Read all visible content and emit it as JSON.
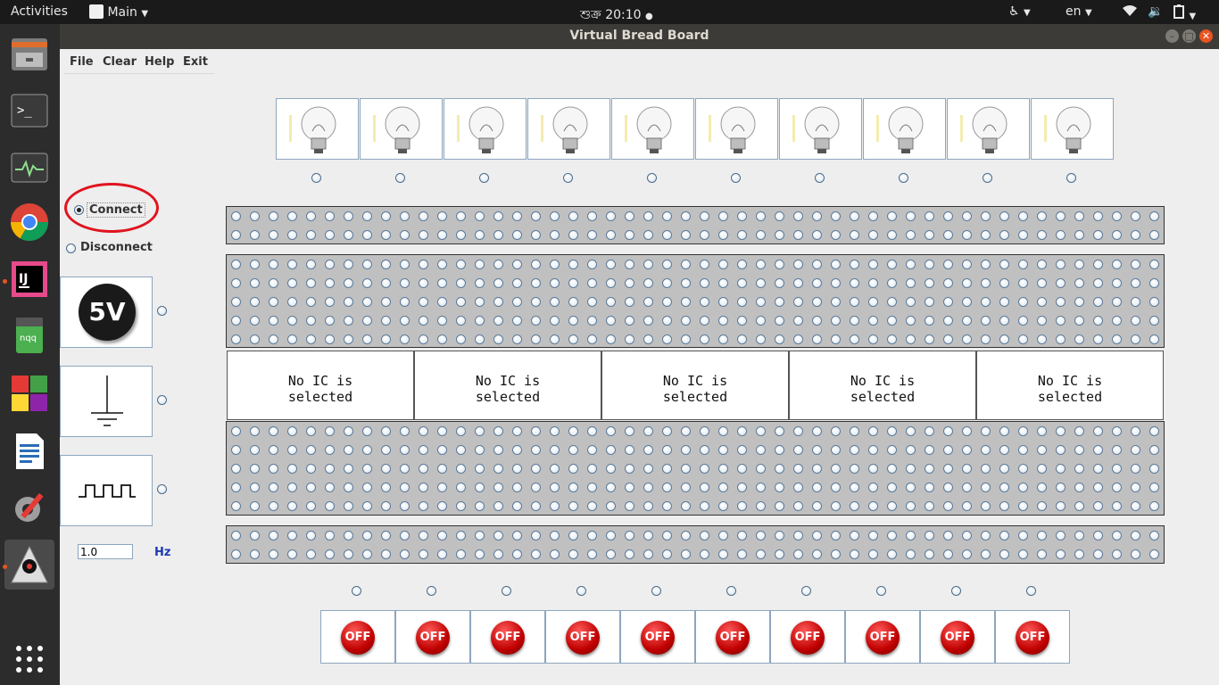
{
  "topbar": {
    "activities": "Activities",
    "app_menu": "Main",
    "clock": "শুক্র 20:10",
    "lang": "en"
  },
  "window": {
    "title": "Virtual Bread Board"
  },
  "menubar": {
    "items": [
      "File",
      "Clear",
      "Help",
      "Exit"
    ]
  },
  "connection": {
    "connect_label": "Connect",
    "disconnect_label": "Disconnect",
    "selected": "Connect"
  },
  "sources": {
    "vcc_label": "5V",
    "clock_freq": "1.0",
    "clock_unit": "Hz"
  },
  "bulbs": {
    "count": 10
  },
  "ic_slots": [
    {
      "line1": "No IC is",
      "line2": "selected"
    },
    {
      "line1": "No IC is",
      "line2": "selected"
    },
    {
      "line1": "No IC is",
      "line2": "selected"
    },
    {
      "line1": "No IC is",
      "line2": "selected"
    },
    {
      "line1": "No IC is",
      "line2": "selected"
    }
  ],
  "switches": {
    "label": "OFF",
    "count": 10
  },
  "breadboard": {
    "holes_per_row": 50,
    "top_rail_rows": 2,
    "upper_block_rows": 5,
    "lower_block_rows": 5,
    "bottom_rail_rows": 2
  },
  "colors": {
    "accent": "#e95420",
    "annotation": "#e0141e",
    "switch_red": "#c00000",
    "panel": "#c0c0c0"
  }
}
